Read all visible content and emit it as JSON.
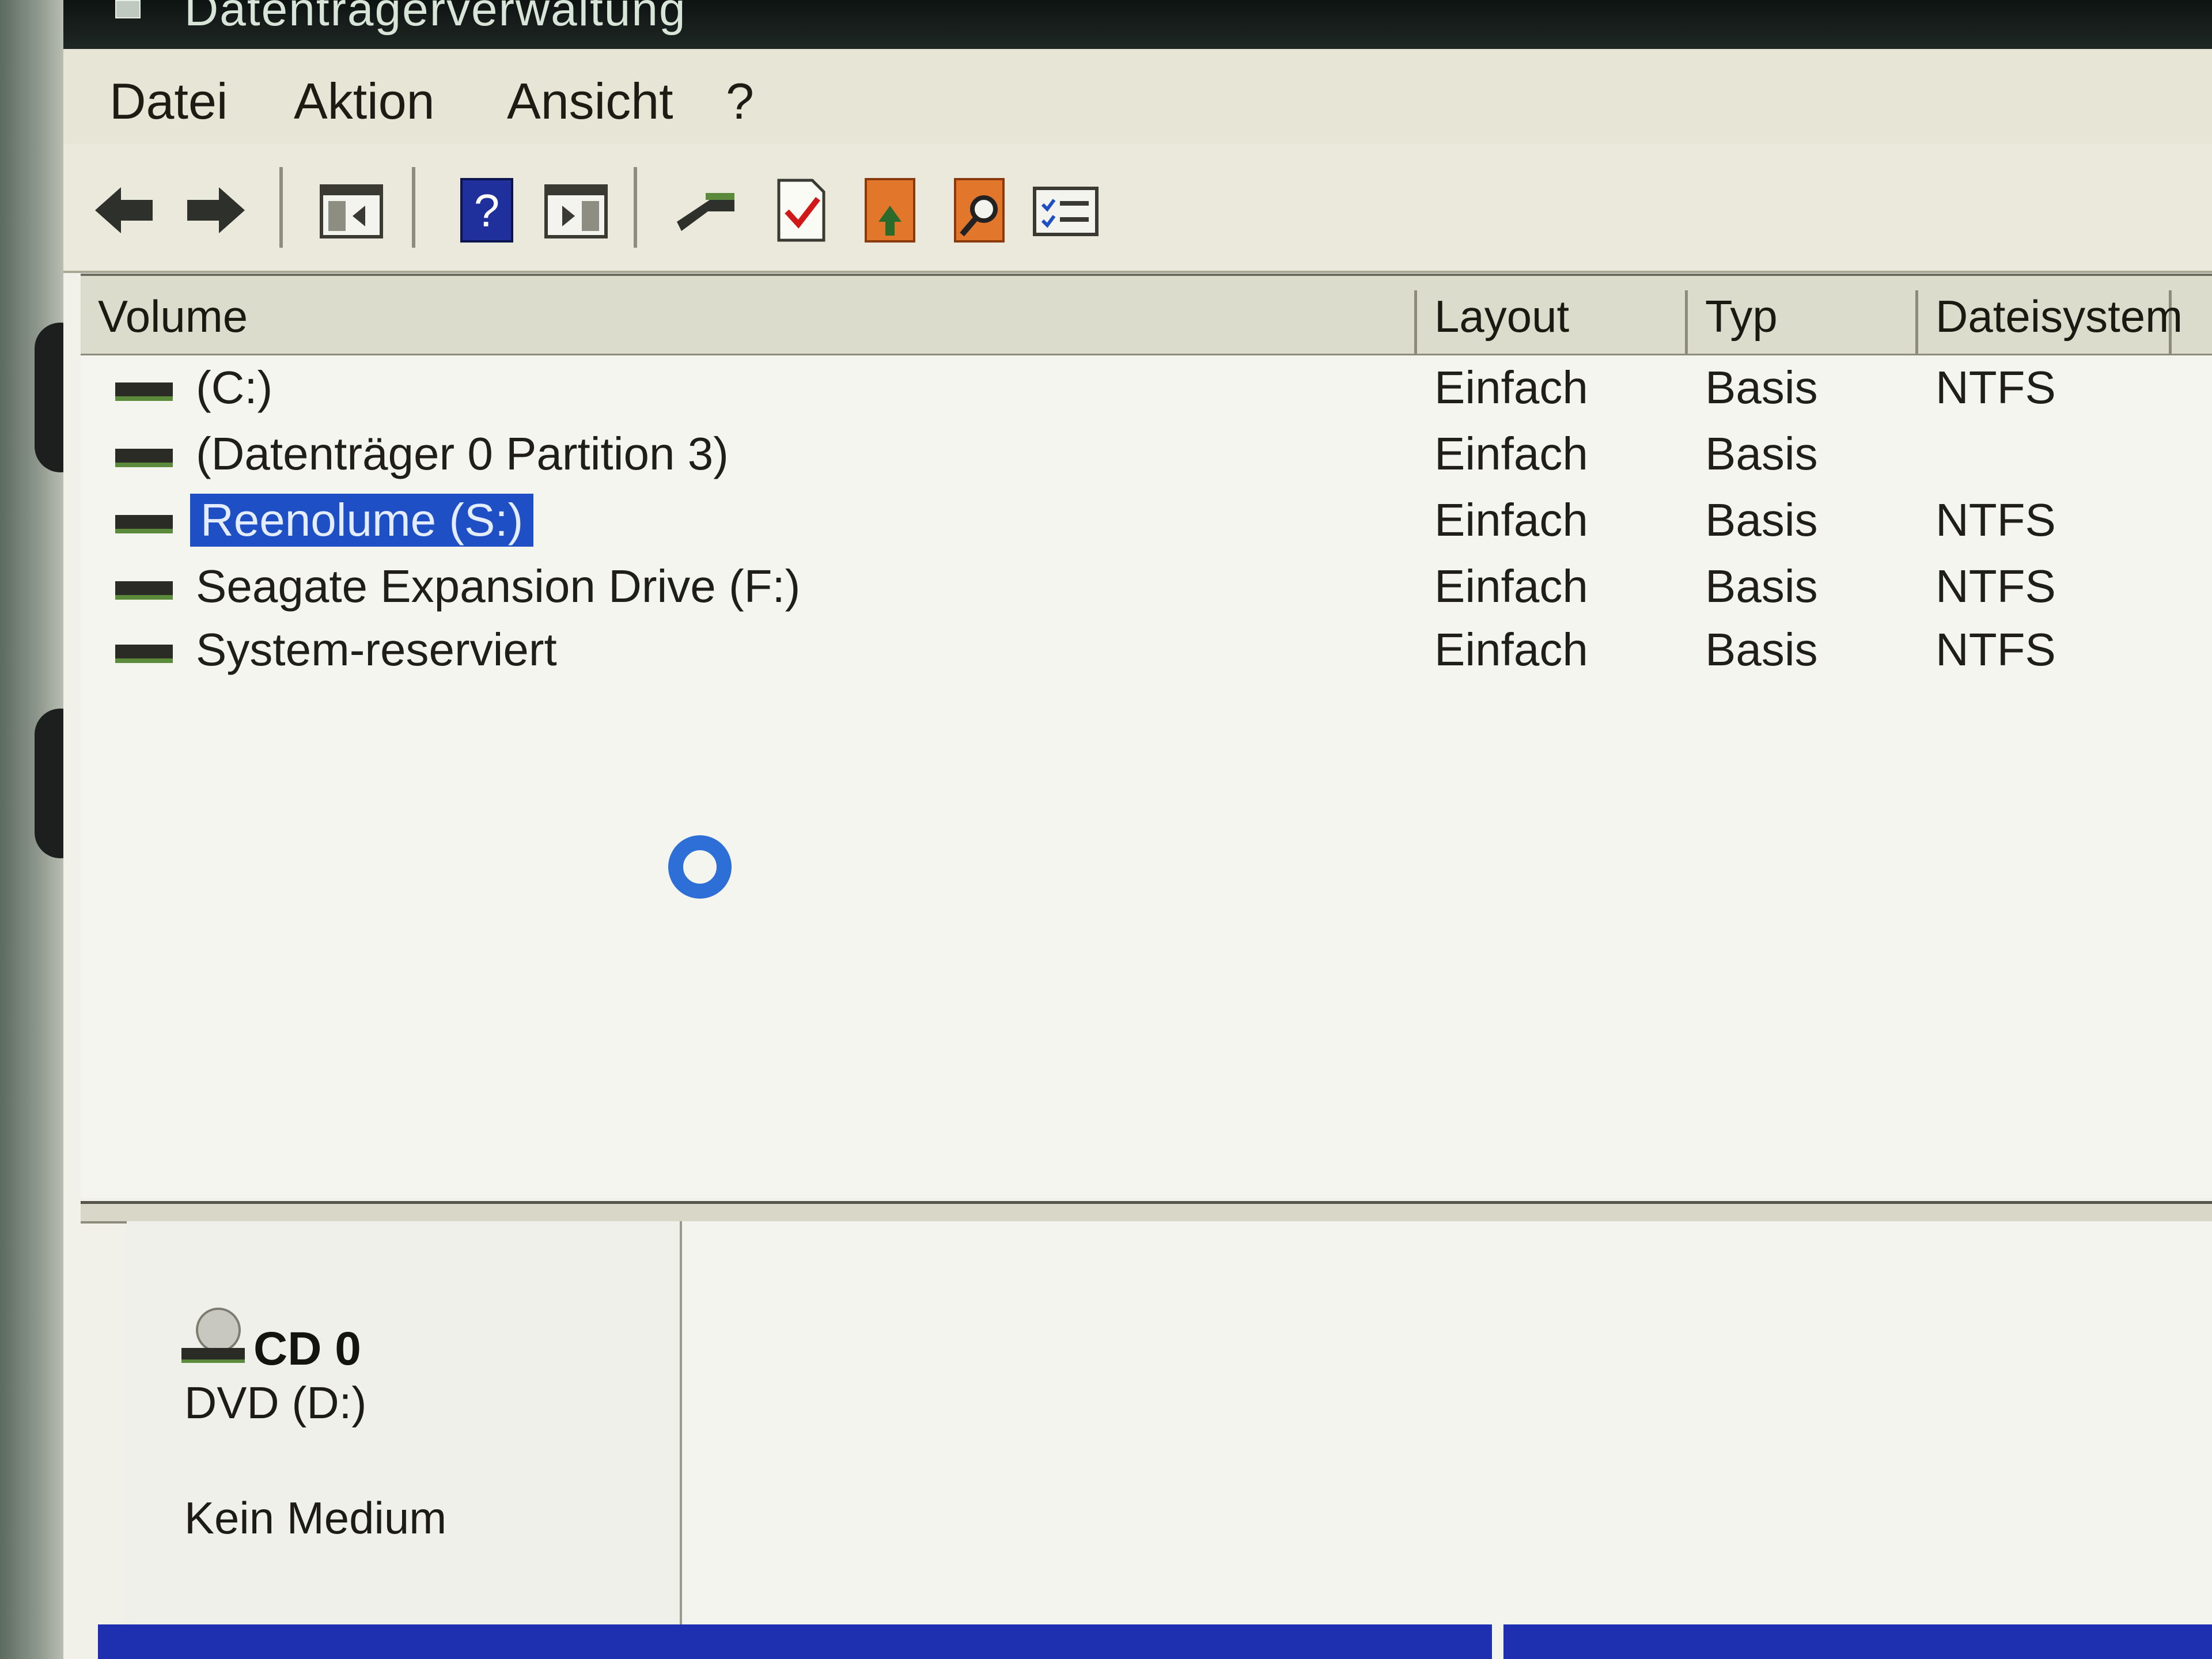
{
  "window": {
    "title": "Datenträgerverwaltung"
  },
  "menu": [
    "Datei",
    "Aktion",
    "Ansicht",
    "?"
  ],
  "toolbar": {
    "buttons": [
      "back-icon",
      "forward-icon",
      "console-tree-icon",
      "help-icon",
      "action-pane-icon",
      "connect-disk-icon",
      "properties-check-icon",
      "rescan-disks-icon",
      "search-disk-icon",
      "settings-list-icon"
    ]
  },
  "volume_list": {
    "columns": [
      "Volume",
      "Layout",
      "Typ",
      "Dateisystem"
    ],
    "rows": [
      {
        "name": "(C:)",
        "layout": "Einfach",
        "typ": "Basis",
        "fs": "NTFS",
        "selected": false
      },
      {
        "name": "(Datenträger 0 Partition 3)",
        "layout": "Einfach",
        "typ": "Basis",
        "fs": "",
        "selected": false
      },
      {
        "name": "Reenolume (S:)",
        "layout": "Einfach",
        "typ": "Basis",
        "fs": "NTFS",
        "selected": true
      },
      {
        "name": "Seagate Expansion Drive (F:)",
        "layout": "Einfach",
        "typ": "Basis",
        "fs": "NTFS",
        "selected": false
      },
      {
        "name": "System-reserviert",
        "layout": "Einfach",
        "typ": "Basis",
        "fs": "NTFS",
        "selected": false
      }
    ]
  },
  "disk_panel": {
    "disk_name": "CD 0",
    "disk_type": "DVD (D:)",
    "status": "Kein Medium"
  },
  "colors": {
    "selection": "#1f4fc4",
    "spinner": "#2d6fd6"
  }
}
